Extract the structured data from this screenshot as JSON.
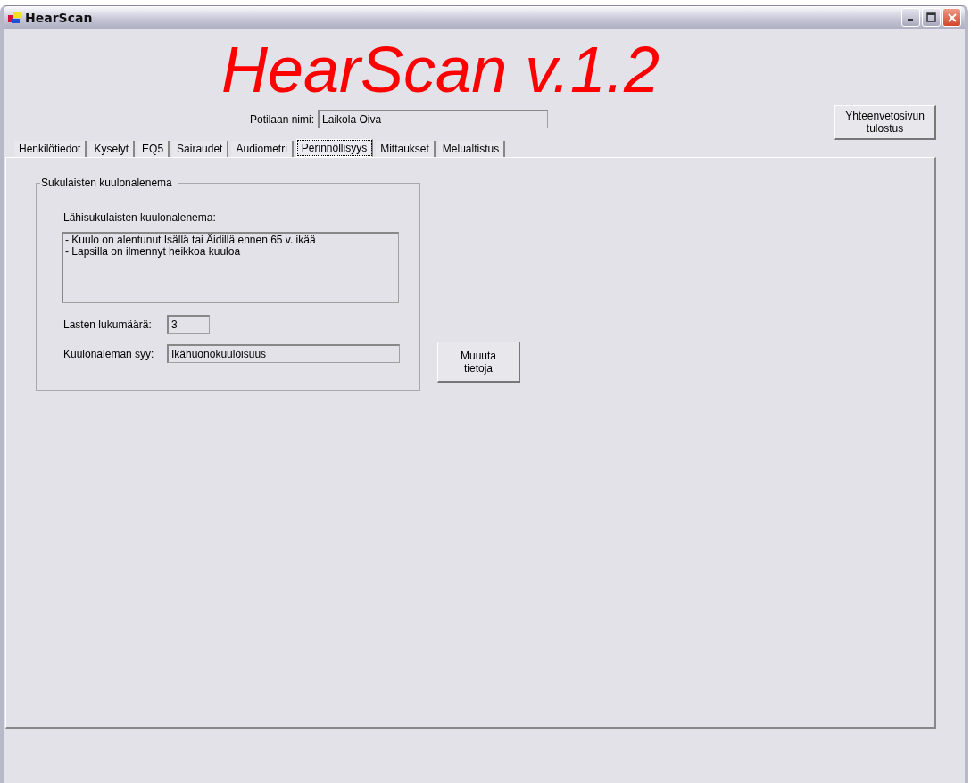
{
  "window": {
    "title": "HearScan"
  },
  "app_title": "HearScan v.1.2",
  "patient": {
    "label": "Potilaan nimi:",
    "value": "Laikola Oiva"
  },
  "print_button": "Yhteenvetosivun tulostus",
  "tabs": [
    {
      "label": "Henkilötiedot",
      "selected": false
    },
    {
      "label": "Kyselyt",
      "selected": false
    },
    {
      "label": "EQ5",
      "selected": false
    },
    {
      "label": "Sairaudet",
      "selected": false
    },
    {
      "label": "Audiometri",
      "selected": false
    },
    {
      "label": "Perinnöllisyys",
      "selected": true
    },
    {
      "label": "Mittaukset",
      "selected": false
    },
    {
      "label": "Melualtistus",
      "selected": false
    }
  ],
  "group": {
    "title": "Sukulaisten kuulonalenema",
    "list_label": "Lähisukulaisten kuulonalenema:",
    "list_lines": [
      "- Kuulo on alentunut Isällä tai Äidillä ennen 65 v. ikää",
      "- Lapsilla on ilmennyt heikkoa kuuloa"
    ],
    "children_label": "Lasten lukumäärä:",
    "children_value": "3",
    "cause_label": "Kuulonaleman syy:",
    "cause_value": "Ikähuonokuuloisuus"
  },
  "edit_button": "Muuuta tietoja"
}
